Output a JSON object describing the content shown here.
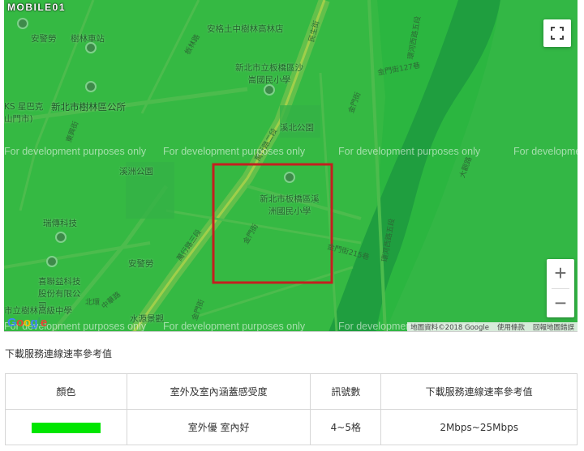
{
  "brand": "MOBILE01",
  "map": {
    "watermark": "For development purposes only",
    "labels": {
      "police_top": "安警勞",
      "mrt_station": "樹林車站",
      "secondary_school": "安格土中樹林高林店",
      "xinbei_elementary": "新北市立板橋區沙崙國民小學",
      "starbucks": "KS 星巴克 山門市)",
      "shulin_office": "新北市樹林區公所",
      "xizhou_park_right": "溪北公園",
      "xizhou_park_left": "溪洲公園",
      "xizhou_school": "新北市板橋區溪洲國民小學",
      "ruiyu": "瑞傳科技",
      "police_bottom": "安警勞",
      "xihe": "喜聯益科技股份有限公司",
      "shulin_high": "市立樹林高級中學",
      "shuiyuan": "水源景觀"
    },
    "streets": {
      "dongxing": "東興街",
      "banlin": "板林路",
      "jiangxing": "民生街",
      "shangdao": "萬行路二段",
      "wanxing3": "萬行路三段",
      "zhonghua": "中華路",
      "jinmen1": "金門街",
      "jinmen2": "金門街",
      "jinmen3": "金門街215巷",
      "jinmen4": "金門街",
      "riverside": "環河西路五段",
      "riverside2": "環河西路五段",
      "daguan": "大觀路",
      "beifu": "北環",
      "datong": "金門街127巷"
    },
    "google_logo": "Google",
    "attribution": [
      "地圖資料©2018 Google",
      "使用條款",
      "回報地圖錯誤"
    ],
    "fullscreen_icon": "fullscreen-icon",
    "zoom_in_label": "+",
    "zoom_out_label": "−"
  },
  "caption": "下載服務連線速率參考值",
  "table": {
    "headers": [
      "顏色",
      "室外及室內涵蓋感受度",
      "訊號數",
      "下載服務連線速率參考值"
    ],
    "rows": [
      {
        "color": "#00e600",
        "coverage": "室外優 室內好",
        "signal": "4~5格",
        "speed": "2Mbps~25Mbps"
      }
    ]
  },
  "colors": {
    "map_green": "#29b53f",
    "highlight_red": "#c41f1f"
  }
}
